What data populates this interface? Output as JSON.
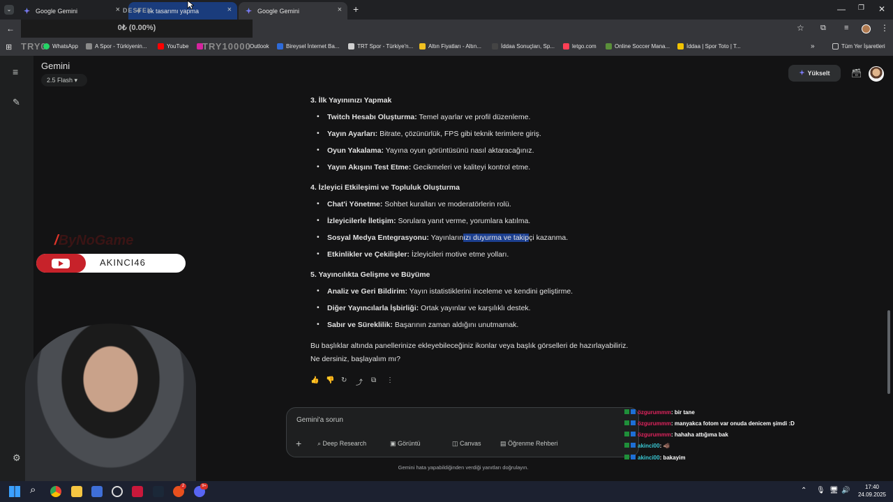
{
  "browser": {
    "tabs": [
      {
        "label": "Google Gemini",
        "active": false
      },
      {
        "label": "ek tasarımı yapma",
        "active": false,
        "overlay_label": "DESTEK"
      },
      {
        "label": "Google Gemini",
        "active": true
      }
    ],
    "overlay_money": "0₺ (0.00%)",
    "bookmarks": [
      "WhatsApp",
      "A Spor - Türkiyenin...",
      "YouTube",
      "Outlook",
      "Bireysel İnternet Ba...",
      "TRT Spor - Türkiye'n...",
      "Altın Fiyatları - Altın...",
      "İddaa Sonuçları, Sp...",
      "letgo.com",
      "Online Soccer Mana...",
      "İddaa | Spor Toto | T..."
    ],
    "all_bookmarks": "Tüm Yer İşaretleri",
    "watermark_left": "TRY0",
    "watermark_right": "TRY10000"
  },
  "gemini": {
    "title": "Gemini",
    "model": "2.5 Flash",
    "upgrade": "Yükselt",
    "sections": [
      {
        "heading": "3. İlk Yayınınızı Yapmak",
        "items": [
          {
            "bold": "Twitch Hesabı Oluşturma:",
            "text": " Temel ayarlar ve profil düzenleme."
          },
          {
            "bold": "Yayın Ayarları:",
            "text": " Bitrate, çözünürlük, FPS gibi teknik terimlere giriş."
          },
          {
            "bold": "Oyun Yakalama:",
            "text": " Yayına oyun görüntüsünü nasıl aktaracağınız."
          },
          {
            "bold": "Yayın Akışını Test Etme:",
            "text": " Gecikmeleri ve kaliteyi kontrol etme."
          }
        ]
      },
      {
        "heading": "4. İzleyici Etkileşimi ve Topluluk Oluşturma",
        "items": [
          {
            "bold": "Chat'i Yönetme:",
            "text": " Sohbet kuralları ve moderatörlerin rolü."
          },
          {
            "bold": "İzleyicilerle İletişim:",
            "text": " Sorulara yanıt verme, yorumlara katılma."
          },
          {
            "bold": "Sosyal Medya Entegrasyonu:",
            "text_pre": " Yayınların",
            "text_hl": "ızı duyurma ve takip",
            "text_post": "çi kazanma."
          },
          {
            "bold": "Etkinlikler ve Çekilişler:",
            "text": " İzleyicileri motive etme yolları."
          }
        ]
      },
      {
        "heading": "5. Yayıncılıkta Gelişme ve Büyüme",
        "items": [
          {
            "bold": "Analiz ve Geri Bildirim:",
            "text": " Yayın istatistiklerini inceleme ve kendini geliştirme."
          },
          {
            "bold": "Diğer Yayıncılarla İşbirliği:",
            "text": " Ortak yayınlar ve karşılıklı destek."
          },
          {
            "bold": "Sabır ve Süreklilik:",
            "text": " Başarının zaman aldığını unutmamak."
          }
        ]
      }
    ],
    "closing_1": "Bu başlıklar altında panellerinize ekleyebileceğiniz ikonlar veya başlık görselleri de hazırlayabiliriz.",
    "closing_2": "Ne dersiniz, başlayalım mı?",
    "input_placeholder": "Gemini'a sorun",
    "tools": [
      "Deep Research",
      "Görüntü",
      "Canvas",
      "Öğrenme Rehberi"
    ],
    "disclaimer": "Gemini hata yapabildiğinden verdiği yanıtları doğrulayın."
  },
  "stream": {
    "brand": "ByNoGame",
    "youtube_name": "AKINCI46",
    "chat": [
      {
        "user": "özgurummm",
        "msg": ": bir tane",
        "color": "#e0245e"
      },
      {
        "user": "özgurummm",
        "msg": ": manyakca fotom var onuda denicem şimdi :D",
        "color": "#e0245e"
      },
      {
        "user": "özgurummm",
        "msg": ": hahaha attığıma bak",
        "color": "#e0245e"
      },
      {
        "user": "akinci00",
        "msg": ": 🐗",
        "color": "#39c7d4"
      },
      {
        "user": "akinci00",
        "msg": ": bakayim",
        "color": "#39c7d4"
      }
    ]
  },
  "taskbar": {
    "time": "17:40",
    "date": "24.09.2025",
    "badge_1": "2",
    "badge_2": "9+"
  }
}
